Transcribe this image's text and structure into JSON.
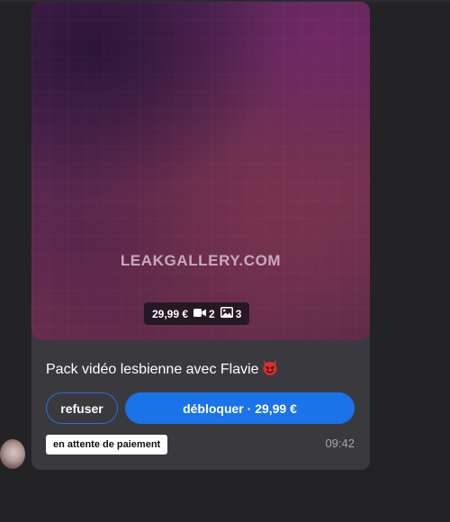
{
  "post": {
    "watermark": "LEAKGALLERY.COM",
    "media": {
      "price": "29,99 €",
      "video_icon": "video-camera-icon",
      "video_count": "2",
      "photo_icon": "image-icon",
      "photo_count": "3"
    },
    "title": "Pack vidéo lesbienne avec Flavie",
    "title_emoji": "devil-face-emoji",
    "refuse_label": "refuser",
    "unlock_label": "débloquer · 29,99 €",
    "status": "en attente de paiement",
    "time": "09:42"
  },
  "colors": {
    "card_bg": "#3a3a3e",
    "page_bg": "#232325",
    "accent": "#1a73e8"
  }
}
